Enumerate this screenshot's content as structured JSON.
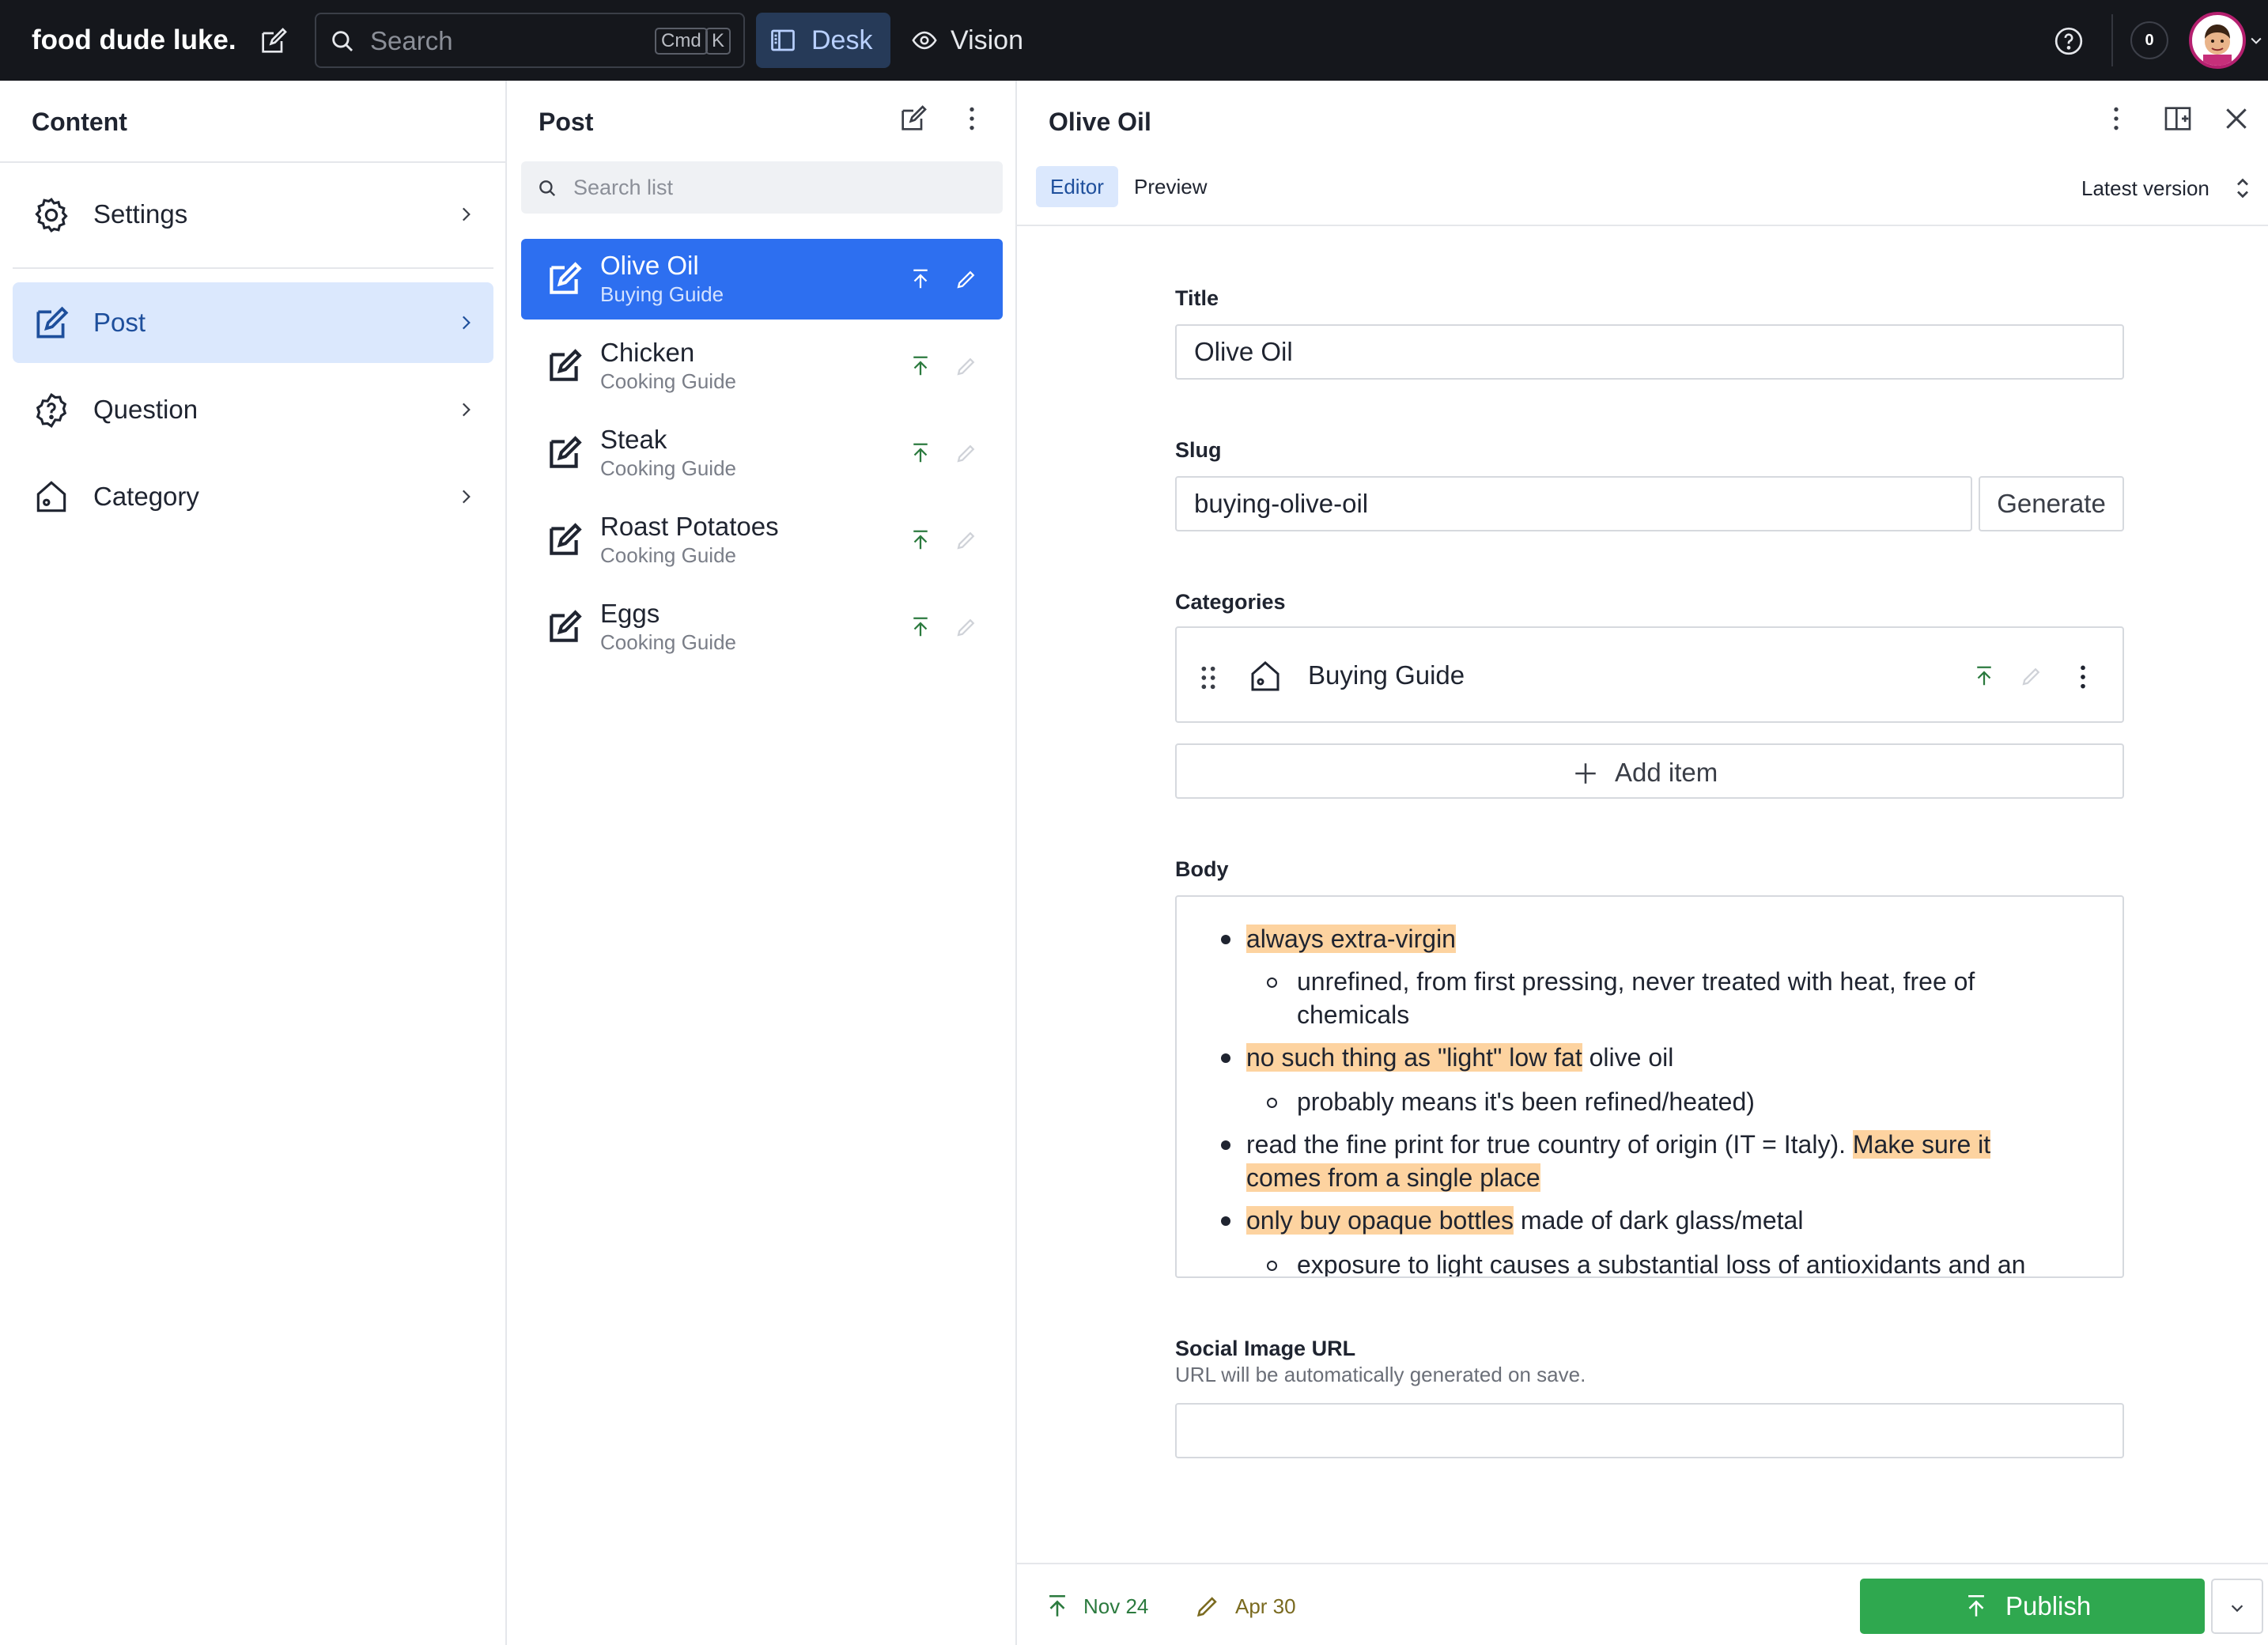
{
  "topbar": {
    "brand": "food dude luke.",
    "search_placeholder": "Search",
    "shortcut_cmd": "Cmd",
    "shortcut_key": "K",
    "tools": [
      {
        "label": "Desk",
        "icon": "desk-icon",
        "active": true
      },
      {
        "label": "Vision",
        "icon": "eye-icon",
        "active": false
      }
    ],
    "notification_count": "0"
  },
  "content_pane": {
    "title": "Content",
    "items": [
      {
        "label": "Settings",
        "icon": "gear-icon",
        "active": false
      },
      {
        "label": "Post",
        "icon": "compose-icon",
        "active": true
      },
      {
        "label": "Question",
        "icon": "question-icon",
        "active": false
      },
      {
        "label": "Category",
        "icon": "tag-icon",
        "active": false
      }
    ]
  },
  "post_pane": {
    "title": "Post",
    "search_placeholder": "Search list",
    "documents": [
      {
        "title": "Olive Oil",
        "subtitle": "Buying Guide",
        "active": true
      },
      {
        "title": "Chicken",
        "subtitle": "Cooking Guide",
        "active": false
      },
      {
        "title": "Steak",
        "subtitle": "Cooking Guide",
        "active": false
      },
      {
        "title": "Roast Potatoes",
        "subtitle": "Cooking Guide",
        "active": false
      },
      {
        "title": "Eggs",
        "subtitle": "Cooking Guide",
        "active": false
      }
    ]
  },
  "document": {
    "title": "Olive Oil",
    "tabs": [
      {
        "label": "Editor",
        "active": true
      },
      {
        "label": "Preview",
        "active": false
      }
    ],
    "version": "Latest version",
    "fields": {
      "title": {
        "label": "Title",
        "value": "Olive Oil"
      },
      "slug": {
        "label": "Slug",
        "value": "buying-olive-oil",
        "button": "Generate"
      },
      "categories": {
        "label": "Categories",
        "items": [
          "Buying Guide"
        ],
        "add_label": "Add item"
      },
      "body": {
        "label": "Body",
        "lines": {
          "l1_hl": "always extra-virgin",
          "l1a": "unrefined, from first pressing, never treated with heat, free of",
          "l1b": "chemicals",
          "l2_hl": "no such thing as \"light\" low fat",
          "l2_rest": " olive oil",
          "l2a": "probably means it's been refined/heated)",
          "l3_plain": "read the fine print for true country of origin (IT = Italy). ",
          "l3_hl1": "Make sure it ",
          "l3_hl2": "comes from a single place",
          "l4_hl": "only buy opaque bottles",
          "l4_rest": " made of dark glass/metal",
          "l4a": "exposure to light causes a substantial loss of antioxidants and an"
        }
      },
      "social": {
        "label": "Social Image URL",
        "description": "URL will be automatically generated on save.",
        "value": ""
      }
    },
    "footer": {
      "published_date": "Nov 24",
      "edited_date": "Apr 30",
      "publish_label": "Publish"
    }
  },
  "colors": {
    "accent": "#2d6ff0",
    "publish_green": "#2fa84f",
    "highlight": "#fdd3a0",
    "topbar": "#15171c"
  }
}
